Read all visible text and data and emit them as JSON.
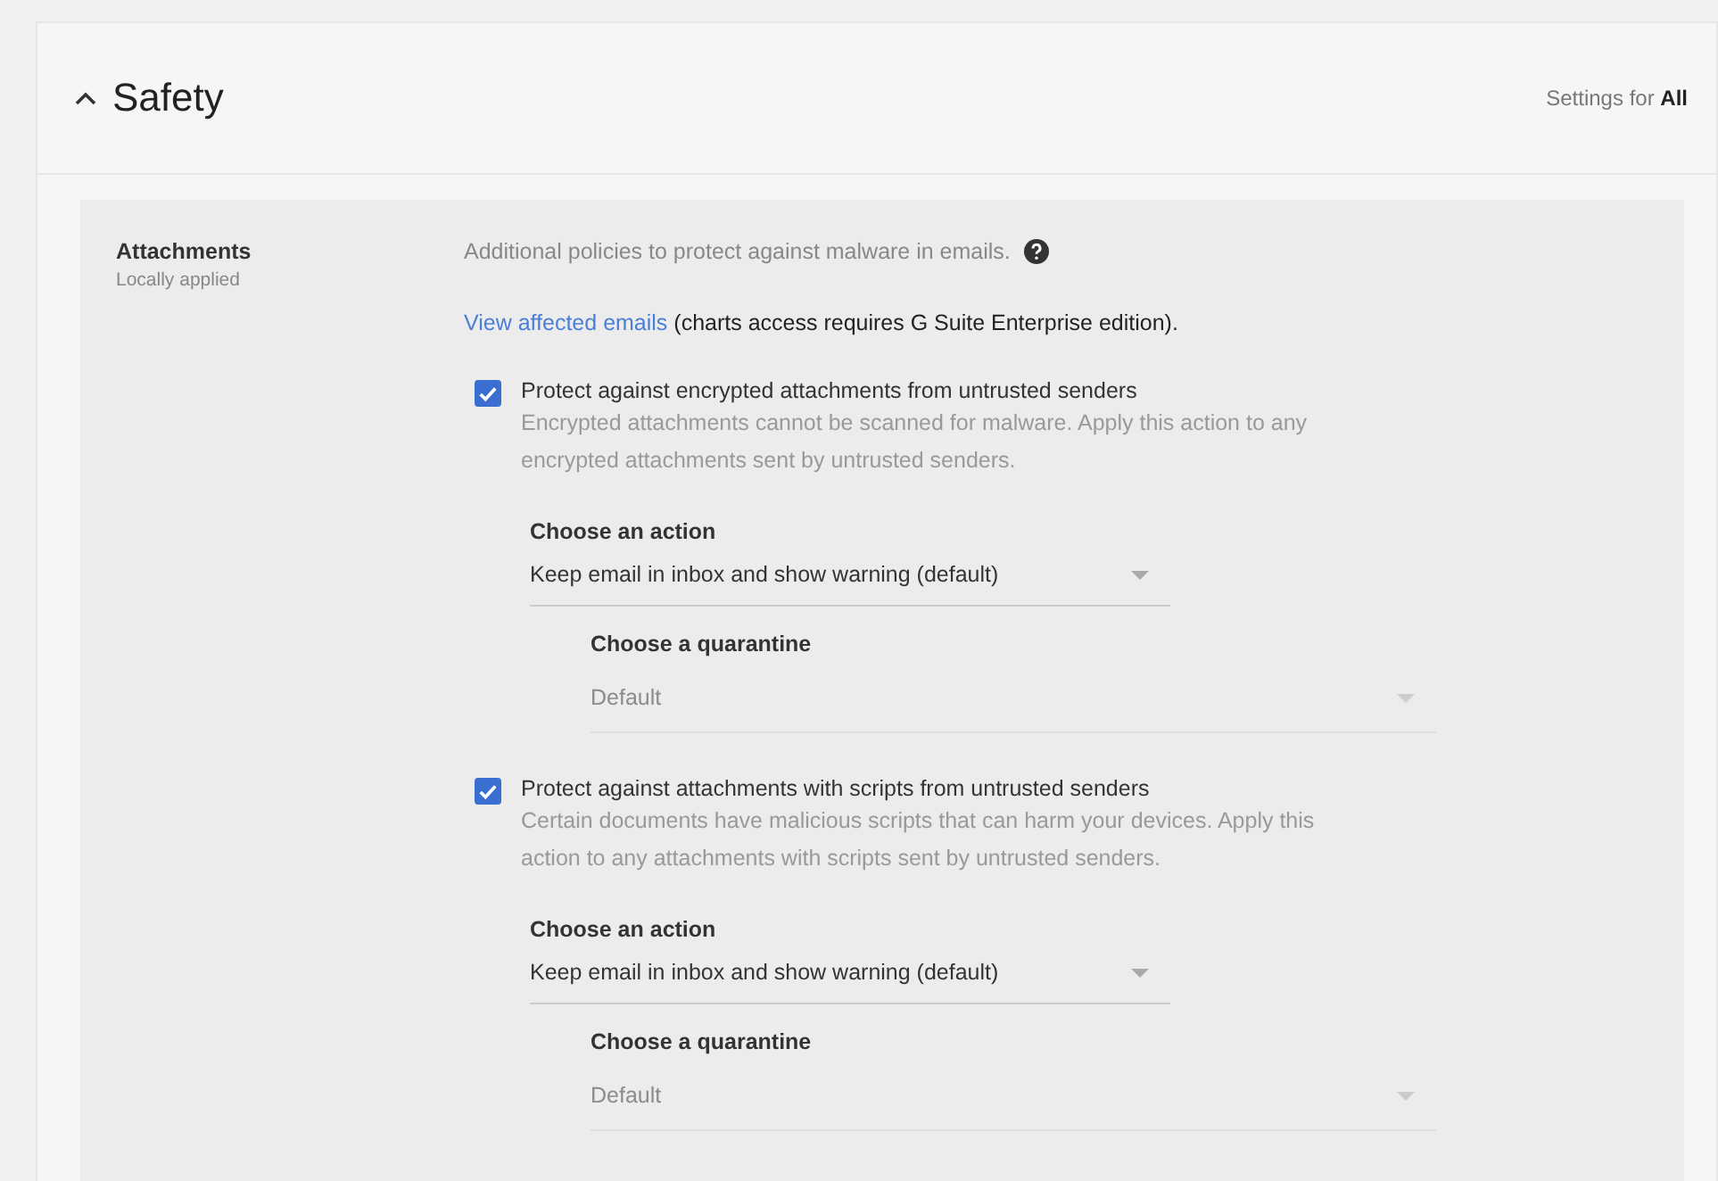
{
  "section": {
    "title": "Safety",
    "expanded": true,
    "scope_label": "Settings for ",
    "scope_value": "All"
  },
  "setting": {
    "name": "Attachments",
    "status": "Locally applied",
    "description": "Additional policies to protect against malware in emails.",
    "link": "View affected emails",
    "link_note": "(charts access requires G Suite Enterprise edition).",
    "options": [
      {
        "label": "Protect against encrypted attachments from untrusted senders",
        "checked": true,
        "help": "Encrypted attachments cannot be scanned for malware. Apply this action to any encrypted attachments sent by untrusted senders.",
        "action_label": "Choose an action",
        "action_value": "Keep email in inbox and show warning (default)",
        "quarantine_label": "Choose a quarantine",
        "quarantine_value": "Default",
        "quarantine_disabled": true
      },
      {
        "label": "Protect against attachments with scripts from untrusted senders",
        "checked": true,
        "help": "Certain documents have malicious scripts that can harm your devices. Apply this action to any attachments with scripts sent by untrusted senders.",
        "action_label": "Choose an action",
        "action_value": "Keep email in inbox and show warning (default)",
        "quarantine_label": "Choose a quarantine",
        "quarantine_value": "Default",
        "quarantine_disabled": true
      }
    ]
  }
}
